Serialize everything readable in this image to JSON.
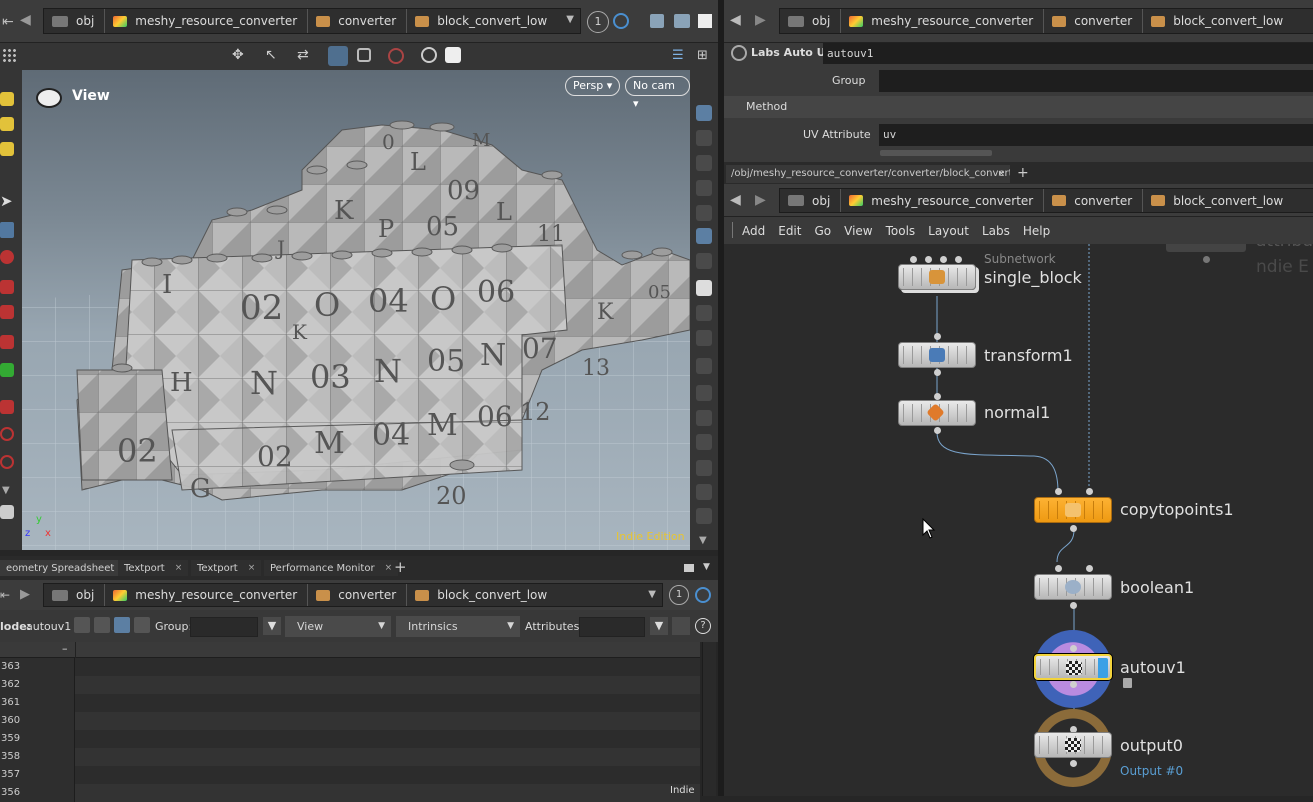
{
  "colors": {
    "accent_orange": "#f5a623",
    "selected_yellow": "#f2d33c",
    "display_blue": "#3aa0e6",
    "link_blue": "#5a9fd4",
    "indie_yellow": "#e8c531"
  },
  "top_path": {
    "items": [
      "obj",
      "meshy_resource_converter",
      "converter",
      "block_convert_low"
    ],
    "desk_num": "1"
  },
  "right_path": {
    "items": [
      "obj",
      "meshy_resource_converter",
      "converter",
      "block_convert_low"
    ]
  },
  "viewport": {
    "title": "View",
    "persp": "Persp ▾",
    "cam": "No cam ▾",
    "watermark": "Indie Edition",
    "axis_z": "z",
    "axis_x": "x",
    "axis_y": "y",
    "block_labels": [
      "02",
      "O",
      "04",
      "O",
      "06",
      "N",
      "03",
      "N",
      "05",
      "N",
      "07",
      "02",
      "M",
      "04",
      "M",
      "06",
      "12",
      "09",
      "K",
      "P",
      "05",
      "L",
      "11",
      "K",
      "13",
      "I",
      "H",
      "G",
      "L",
      "M",
      "K",
      "J",
      "0",
      "05",
      "02",
      "20"
    ]
  },
  "params": {
    "node_type": "Labs Auto UV",
    "node_name": "autouv1",
    "group_label": "Group",
    "group_value": "",
    "method_label": "Method",
    "uv_label": "UV Attribute",
    "uv_value": "uv"
  },
  "network_tab": {
    "path": "/obj/meshy_resource_converter/converter/block_convert_...",
    "close": "×",
    "plus": "+"
  },
  "net_menu": [
    "Add",
    "Edit",
    "Go",
    "View",
    "Tools",
    "Layout",
    "Labs",
    "Help"
  ],
  "nodes": {
    "subnet_label": "Subnetwork",
    "single_block": "single_block",
    "transform1": "transform1",
    "normal1": "normal1",
    "copytopoints1": "copytopoints1",
    "boolean1": "boolean1",
    "autouv1": "autouv1",
    "output0": "output0",
    "output_sub": "Output #0",
    "ghost1": "attributi",
    "ghost2": "ndie E"
  },
  "bottom_tabs": [
    {
      "label": "eometry Spreadsheet",
      "close": "×"
    },
    {
      "label": "Textport",
      "close": "×"
    },
    {
      "label": "Textport",
      "close": "×"
    },
    {
      "label": "Performance Monitor",
      "close": "×"
    }
  ],
  "bottom_plus": "+",
  "bottom_path": {
    "items": [
      "obj",
      "meshy_resource_converter",
      "converter",
      "block_convert_low"
    ],
    "desk_num": "1"
  },
  "spreadsheet": {
    "node_prefix": "lode:",
    "node_name": "autouv1",
    "group_label": "Group:",
    "view_label": "View",
    "intrinsics_label": "Intrinsics",
    "attr_label": "Attributes:",
    "col_header": "–",
    "rows": [
      "363",
      "362",
      "361",
      "360",
      "359",
      "358",
      "357",
      "356"
    ],
    "indie": "Indie"
  }
}
